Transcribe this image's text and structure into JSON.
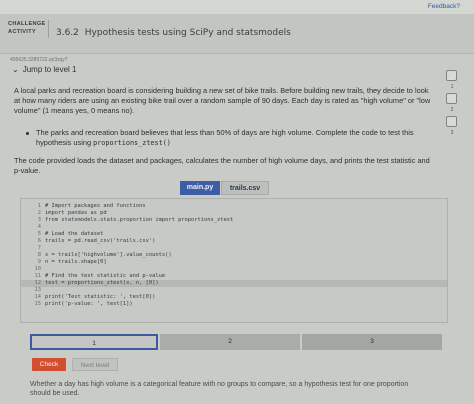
{
  "feedback_label": "Feedback?",
  "header": {
    "challenge_line1": "CHALLENGE",
    "challenge_line2": "ACTIVITY",
    "section_number": "3.6.2",
    "section_title": "Hypothesis tests using SciPy and statsmodels",
    "activity_id": "495625.3289722.qx3zqy7"
  },
  "jump_label": "Jump to level 1",
  "levels": [
    "1",
    "2",
    "3"
  ],
  "description": {
    "paragraph": "A local parks and recreation board is considering building a new set of bike trails. Before building new trails, they decide to look at how many riders are using an existing bike trail over a random sample of 90 days. Each day is rated as \"high volume\" or \"low volume\" (1 means yes, 0 means no).",
    "bullet_text": "The parks and recreation board believes that less than 50% of days are high volume. Complete the code to test this hypothesis using",
    "bullet_code": "proportions_ztest()",
    "task": "The code provided loads the dataset and packages, calculates the number of high volume days, and prints the test statistic and p-value."
  },
  "tabs": {
    "main": "main.py",
    "trails": "trails.csv"
  },
  "code_lines": [
    {
      "n": "1",
      "text": "# Import packages and functions"
    },
    {
      "n": "2",
      "text": "import pandas as pd"
    },
    {
      "n": "3",
      "text": "from statsmodels.stats.proportion import proportions_ztest"
    },
    {
      "n": "4",
      "text": ""
    },
    {
      "n": "5",
      "text": "# Load the dataset"
    },
    {
      "n": "6",
      "text": "trails = pd.read_csv('trails.csv')"
    },
    {
      "n": "7",
      "text": ""
    },
    {
      "n": "8",
      "text": "x = trails['highvolume'].value_counts()"
    },
    {
      "n": "9",
      "text": "n = trails.shape[0]"
    },
    {
      "n": "10",
      "text": ""
    },
    {
      "n": "11",
      "text": "# Find the test statistic and p-value"
    },
    {
      "n": "12",
      "text": "test = proportions_ztest(x, n, [0])"
    },
    {
      "n": "13",
      "text": ""
    },
    {
      "n": "14",
      "text": "print('Test statistic: ', test[0])"
    },
    {
      "n": "15",
      "text": "print('p-value: ', test[1])"
    }
  ],
  "progress": [
    "1",
    "2",
    "3"
  ],
  "buttons": {
    "check": "Check",
    "next": "Next level"
  },
  "explanation": "Whether a day has high volume is a categorical feature with no groups to compare, so a hypothesis test for one proportion should be used."
}
